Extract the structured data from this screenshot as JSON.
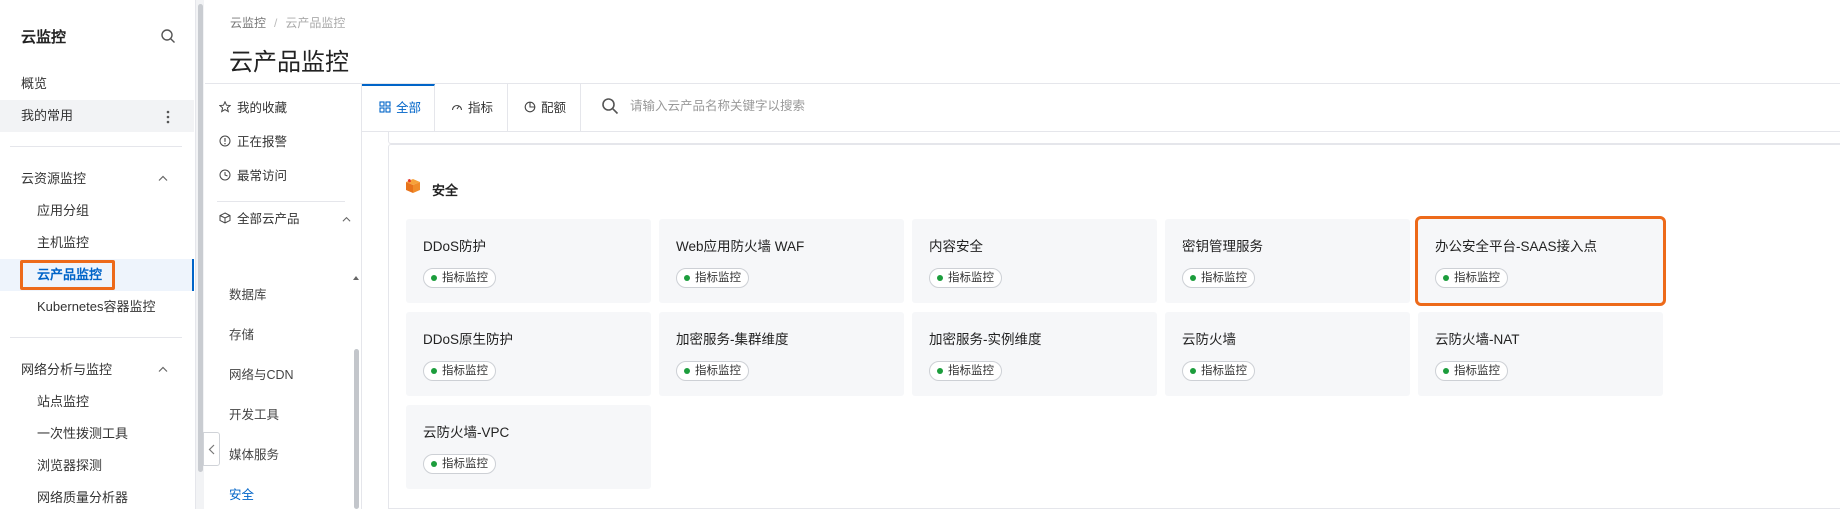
{
  "nav": {
    "title": "云监控",
    "overview": "概览",
    "favorites": "我的常用",
    "resource_group": {
      "label": "云资源监控",
      "items": [
        "应用分组",
        "主机监控",
        "云产品监控",
        "Kubernetes容器监控"
      ]
    },
    "network_group": {
      "label": "网络分析与监控",
      "items": [
        "站点监控",
        "一次性拨测工具",
        "浏览器探测",
        "网络质量分析器"
      ]
    }
  },
  "breadcrumb": {
    "root": "云监控",
    "sep": "/",
    "current": "云产品监控"
  },
  "page_title": "云产品监控",
  "categories": {
    "favorites": "我的收藏",
    "alerting": "正在报警",
    "recent": "最常访问",
    "all_products": "全部云产品",
    "subs": [
      "数据库",
      "存储",
      "网络与CDN",
      "开发工具",
      "媒体服务",
      "安全"
    ]
  },
  "tabs": {
    "all": "全部",
    "metrics": "指标",
    "quota": "配额"
  },
  "search": {
    "placeholder": "请输入云产品名称关键字以搜索",
    "value": ""
  },
  "section": {
    "title": "安全"
  },
  "badge": "指标监控",
  "products": [
    "DDoS防护",
    "Web应用防火墙 WAF",
    "内容安全",
    "密钥管理服务",
    "办公安全平台-SAAS接入点",
    "DDoS原生防护",
    "加密服务-集群维度",
    "加密服务-实例维度",
    "云防火墙",
    "云防火墙-NAT",
    "云防火墙-VPC"
  ],
  "colors": {
    "accent": "#0064c8",
    "highlight": "#ed6a1a",
    "status_ok": "#1c9d3c"
  }
}
